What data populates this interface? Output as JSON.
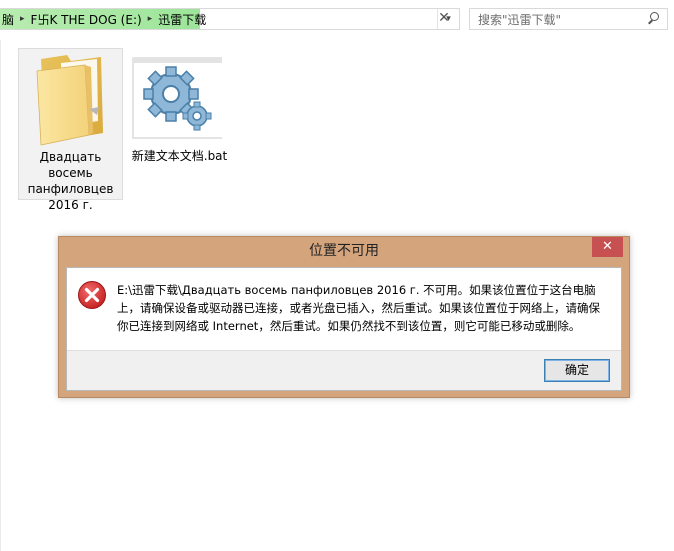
{
  "breadcrumb": {
    "items": [
      "脑",
      "F卐K THE DOG (E:)",
      "迅雷下载"
    ],
    "separator": "▸",
    "dropdown": "▾"
  },
  "nav": {
    "close_glyph": "✕"
  },
  "search": {
    "placeholder": "搜索\"迅雷下载\""
  },
  "files": [
    {
      "name": "Двадцать восемь панфиловцев 2016 г.",
      "icon": "folder-icon",
      "selected": true
    },
    {
      "name": "新建文本文档.bat",
      "icon": "bat-gear-icon",
      "selected": false
    }
  ],
  "dialog": {
    "title": "位置不可用",
    "close_glyph": "✕",
    "message": "E:\\迅雷下载\\Двадцать восемь панфиловцев 2016 г. 不可用。如果该位置位于这台电脑上，请确保设备或驱动器已连接，或者光盘已插入，然后重试。如果该位置位于网络上，请确保你已连接到网络或 Internet，然后重试。如果仍然找不到该位置，则它可能已移动或删除。",
    "ok_label": "确定",
    "icon": "error-icon"
  },
  "colors": {
    "dialog_frame": "#d4a47d",
    "close_button": "#c75050",
    "breadcrumb_highlight": "#9de59a",
    "error_red": "#d62b2b"
  }
}
